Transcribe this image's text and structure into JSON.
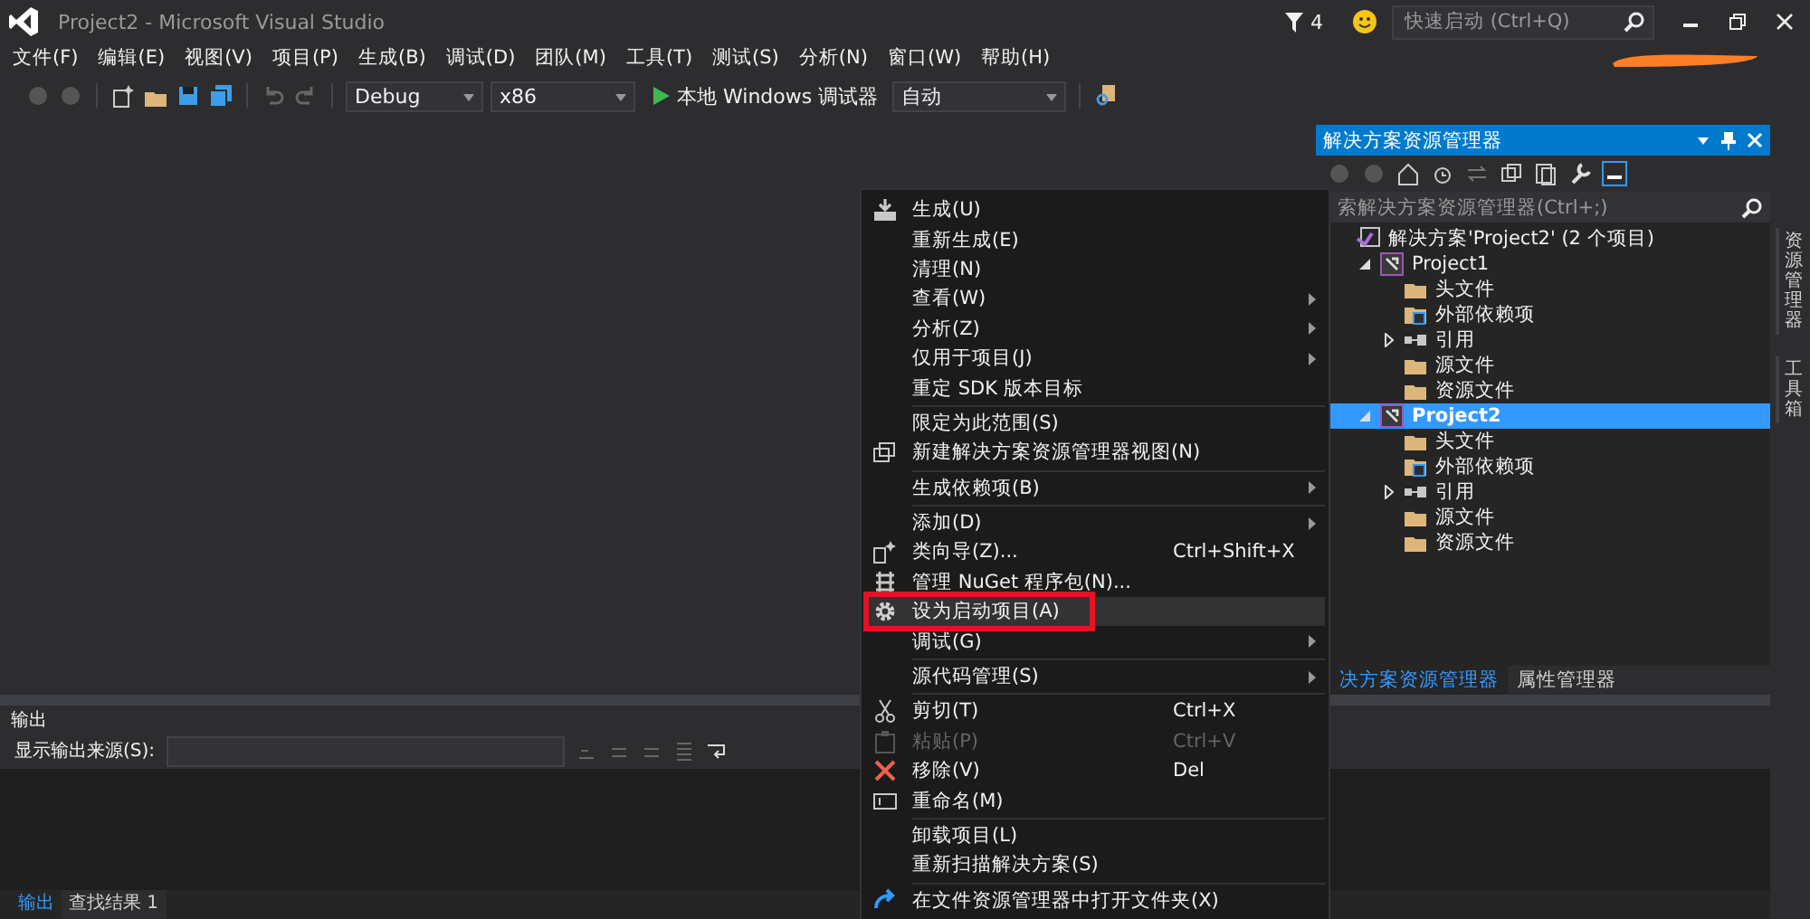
{
  "window": {
    "title": "Project2 - Microsoft Visual Studio",
    "notifications": "4",
    "quick_launch": {
      "placeholder": "快速启动 (Ctrl+Q)"
    }
  },
  "menubar": [
    "文件(F)",
    "编辑(E)",
    "视图(V)",
    "项目(P)",
    "生成(B)",
    "调试(D)",
    "团队(M)",
    "工具(T)",
    "测试(S)",
    "分析(N)",
    "窗口(W)",
    "帮助(H)"
  ],
  "toolbar": {
    "configuration": "Debug",
    "platform": "x86",
    "debugger": "本地 Windows 调试器",
    "target": "自动"
  },
  "solution_explorer": {
    "title": "解决方案资源管理器",
    "search": {
      "placeholder": "索解决方案资源管理器(Ctrl+;)"
    },
    "tree": [
      {
        "label": "解决方案'Project2' (2 个项目)",
        "kind": "solution",
        "selected": false,
        "children": [
          {
            "label": "Project1",
            "kind": "project",
            "expanded": true,
            "selected": false,
            "children": [
              {
                "label": "头文件",
                "kind": "folder",
                "selected": false
              },
              {
                "label": "外部依赖项",
                "kind": "deps",
                "selected": false
              },
              {
                "label": "引用",
                "kind": "refs",
                "expanded": false,
                "selected": false
              },
              {
                "label": "源文件",
                "kind": "folder",
                "selected": false
              },
              {
                "label": "资源文件",
                "kind": "folder",
                "selected": false
              }
            ]
          },
          {
            "label": "Project2",
            "kind": "project",
            "expanded": true,
            "selected": true,
            "children": [
              {
                "label": "头文件",
                "kind": "folder",
                "selected": false
              },
              {
                "label": "外部依赖项",
                "kind": "deps",
                "selected": false
              },
              {
                "label": "引用",
                "kind": "refs",
                "expanded": false,
                "selected": false
              },
              {
                "label": "源文件",
                "kind": "folder",
                "selected": false
              },
              {
                "label": "资源文件",
                "kind": "folder",
                "selected": false
              }
            ]
          }
        ]
      }
    ],
    "tabs": [
      {
        "label": "决方案资源管理器",
        "selected": true
      },
      {
        "label": "属性管理器",
        "selected": false
      }
    ]
  },
  "side_tabs": [
    "资源管理器",
    "工具箱"
  ],
  "output": {
    "title": "输出",
    "source_label": "显示输出来源(S):",
    "tabs": [
      {
        "label": "输出",
        "selected": true
      },
      {
        "label": "查找结果 1",
        "selected": false
      }
    ]
  },
  "context_menu": [
    {
      "kind": "build",
      "label": "生成(U)",
      "selected": false
    },
    {
      "kind": "item",
      "label": "重新生成(E)",
      "selected": false
    },
    {
      "kind": "item",
      "label": "清理(N)",
      "selected": false
    },
    {
      "kind": "item",
      "label": "查看(W)",
      "submenu": true,
      "selected": false
    },
    {
      "kind": "item",
      "label": "分析(Z)",
      "submenu": true,
      "selected": false
    },
    {
      "kind": "item",
      "label": "仅用于项目(J)",
      "submenu": true,
      "selected": false
    },
    {
      "kind": "item",
      "label": "重定 SDK 版本目标",
      "selected": false
    },
    {
      "kind": "separator"
    },
    {
      "kind": "item",
      "label": "限定为此范围(S)",
      "selected": false
    },
    {
      "kind": "windows",
      "label": "新建解决方案资源管理器视图(N)",
      "selected": false
    },
    {
      "kind": "separator"
    },
    {
      "kind": "item",
      "label": "生成依赖项(B)",
      "submenu": true,
      "selected": false
    },
    {
      "kind": "separator"
    },
    {
      "kind": "item",
      "label": "添加(D)",
      "submenu": true,
      "selected": false
    },
    {
      "kind": "wizard",
      "label": "类向导(Z)...",
      "shortcut": "Ctrl+Shift+X",
      "selected": false
    },
    {
      "kind": "package",
      "label": "管理 NuGet 程序包(N)...",
      "selected": false
    },
    {
      "kind": "gear",
      "label": "设为启动项目(A)",
      "selected": true,
      "annotation_box": true
    },
    {
      "kind": "item",
      "label": "调试(G)",
      "submenu": true,
      "selected": false
    },
    {
      "kind": "separator"
    },
    {
      "kind": "item",
      "label": "源代码管理(S)",
      "submenu": true,
      "selected": false
    },
    {
      "kind": "separator"
    },
    {
      "kind": "cut",
      "label": "剪切(T)",
      "shortcut": "Ctrl+X",
      "selected": false
    },
    {
      "kind": "paste",
      "label": "粘贴(P)",
      "shortcut": "Ctrl+V",
      "disabled": true,
      "selected": false
    },
    {
      "kind": "remove",
      "label": "移除(V)",
      "shortcut": "Del",
      "selected": false
    },
    {
      "kind": "rename",
      "label": "重命名(M)",
      "selected": false
    },
    {
      "kind": "separator"
    },
    {
      "kind": "item",
      "label": "卸载项目(L)",
      "selected": false
    },
    {
      "kind": "item",
      "label": "重新扫描解决方案(S)",
      "selected": false
    },
    {
      "kind": "separator"
    },
    {
      "kind": "open",
      "label": "在文件资源管理器中打开文件夹(X)",
      "selected": false
    }
  ]
}
